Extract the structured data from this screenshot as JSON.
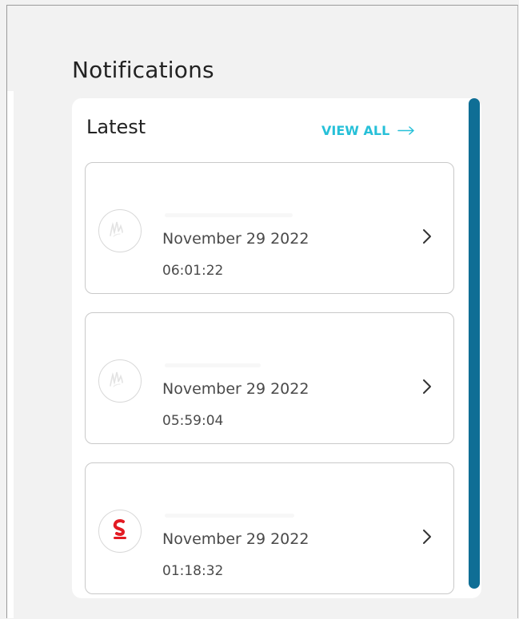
{
  "page": {
    "title": "Notifications"
  },
  "panel": {
    "title": "Latest",
    "view_all_label": "VIEW ALL",
    "view_all_icon": "arrow-right-icon",
    "accent_color": "#27c0d8",
    "scrollbar_color": "#0f6e95"
  },
  "notifications": [
    {
      "date": "November 29 2022",
      "time": "06:01:22",
      "avatar_icon": "placeholder-logo-icon",
      "chevron_icon": "chevron-right-icon"
    },
    {
      "date": "November 29 2022",
      "time": "05:59:04",
      "avatar_icon": "placeholder-logo-icon",
      "chevron_icon": "chevron-right-icon"
    },
    {
      "date": "November 29 2022",
      "time": "01:18:32",
      "avatar_icon": "scotiabank-logo-icon",
      "chevron_icon": "chevron-right-icon"
    }
  ]
}
